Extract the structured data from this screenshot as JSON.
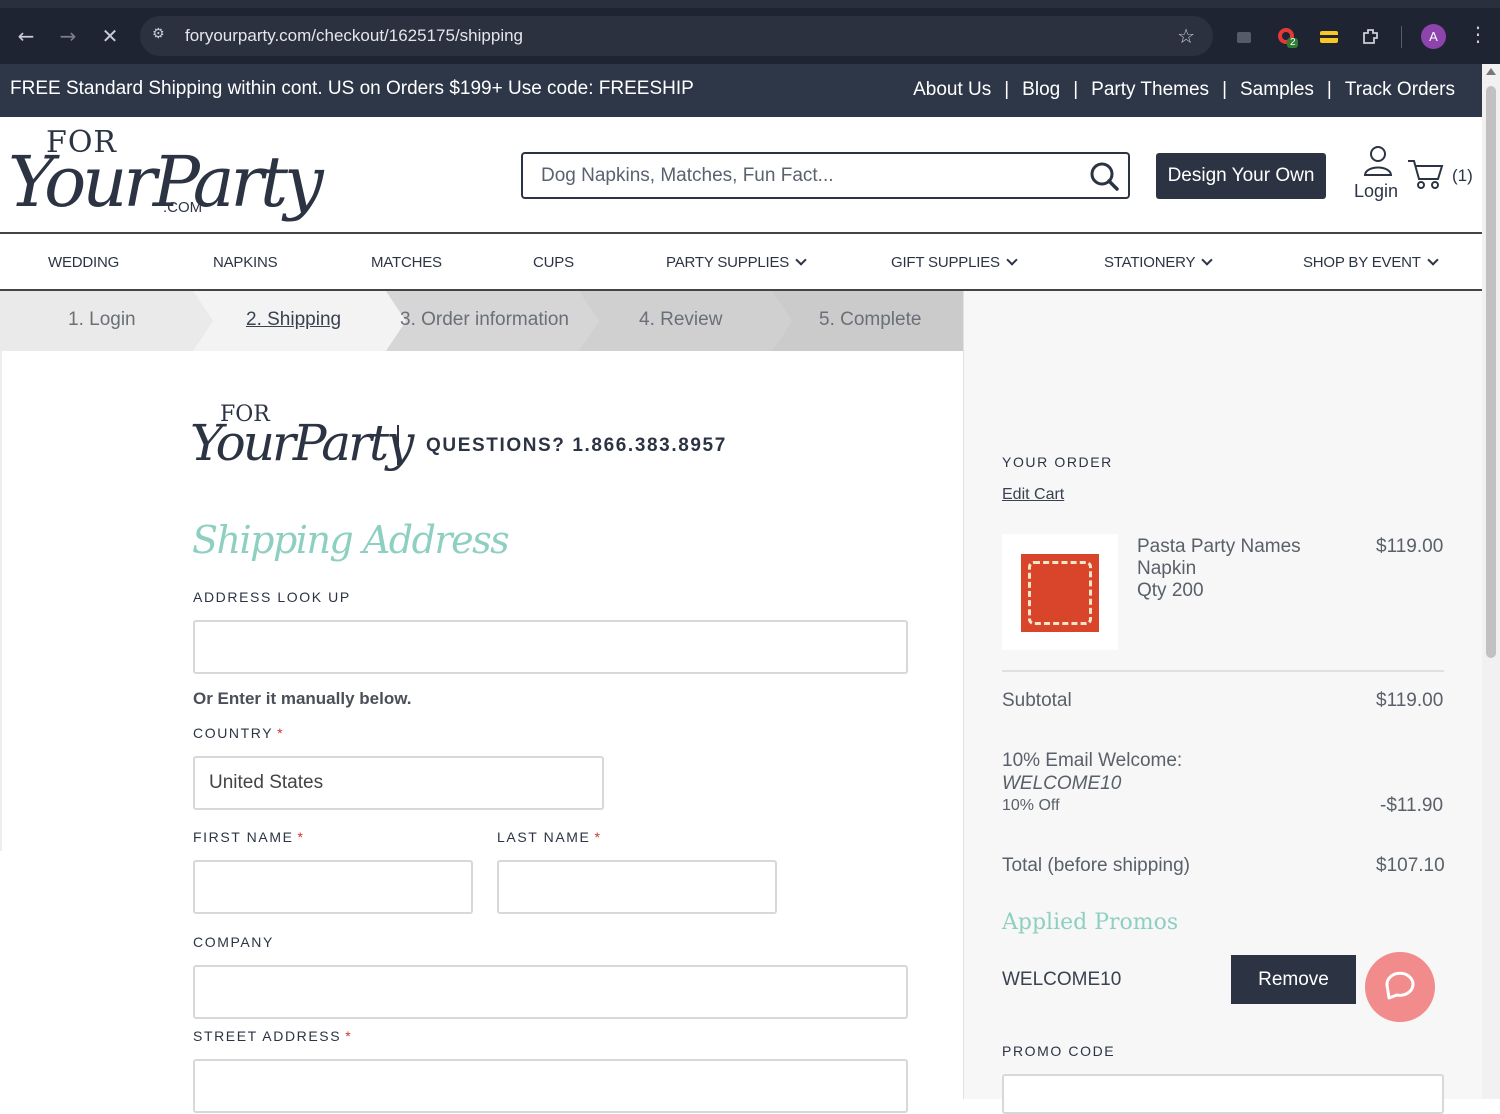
{
  "browser": {
    "url": "foryourparty.com/checkout/1625175/shipping",
    "profile_initial": "A",
    "extension_badge": "2"
  },
  "promo_bar": {
    "text": "FREE Standard Shipping within cont. US on Orders $199+ Use code: FREESHIP",
    "links": [
      "About Us",
      "Blog",
      "Party Themes",
      "Samples",
      "Track Orders"
    ]
  },
  "header": {
    "logo_text": "YourParty",
    "logo_top": "FOR",
    "logo_com": ".COM",
    "search_placeholder": "Dog Napkins, Matches, Fun Fact...",
    "design_button": "Design Your Own",
    "login_label": "Login",
    "cart_count": "(1)"
  },
  "categories": [
    {
      "label": "WEDDING",
      "dropdown": false
    },
    {
      "label": "NAPKINS",
      "dropdown": false
    },
    {
      "label": "MATCHES",
      "dropdown": false
    },
    {
      "label": "CUPS",
      "dropdown": false
    },
    {
      "label": "PARTY SUPPLIES",
      "dropdown": true
    },
    {
      "label": "GIFT SUPPLIES",
      "dropdown": true
    },
    {
      "label": "STATIONERY",
      "dropdown": true
    },
    {
      "label": "SHOP BY EVENT",
      "dropdown": true
    }
  ],
  "steps": [
    {
      "label": "1. Login",
      "active": false
    },
    {
      "label": "2. Shipping",
      "active": true
    },
    {
      "label": "3. Order information",
      "active": false
    },
    {
      "label": "4. Review",
      "active": false
    },
    {
      "label": "5. Complete",
      "active": false
    }
  ],
  "form": {
    "logo_top": "FOR",
    "logo_text": "YourParty",
    "questions": "QUESTIONS? 1.866.383.8957",
    "heading": "Shipping Address",
    "address_lookup_label": "ADDRESS LOOK UP",
    "address_lookup_value": "",
    "manual_note": "Or Enter it manually below.",
    "country_label": "COUNTRY",
    "country_value": "United States",
    "first_name_label": "FIRST NAME",
    "last_name_label": "LAST NAME",
    "company_label": "COMPANY",
    "street_label": "STREET ADDRESS",
    "required_mark": "*"
  },
  "order": {
    "title": "YOUR ORDER",
    "edit_cart": "Edit Cart",
    "item": {
      "name_line1": "Pasta Party Names",
      "name_line2": "Napkin",
      "qty": "Qty 200",
      "price": "$119.00",
      "thumb_color": "#d8452b"
    },
    "subtotal_label": "Subtotal",
    "subtotal_value": "$119.00",
    "discount_label": "10% Email Welcome:",
    "discount_code": "WELCOME10",
    "discount_note": "10% Off",
    "discount_value": "-$11.90",
    "total_label": "Total (before shipping)",
    "total_value": "$107.10",
    "applied_title": "Applied Promos",
    "applied_code": "WELCOME10",
    "remove_button": "Remove",
    "promo_label": "PROMO CODE"
  },
  "colors": {
    "navy": "#2c3444",
    "mint": "#8dcfc0",
    "chat": "#f28b8b"
  }
}
